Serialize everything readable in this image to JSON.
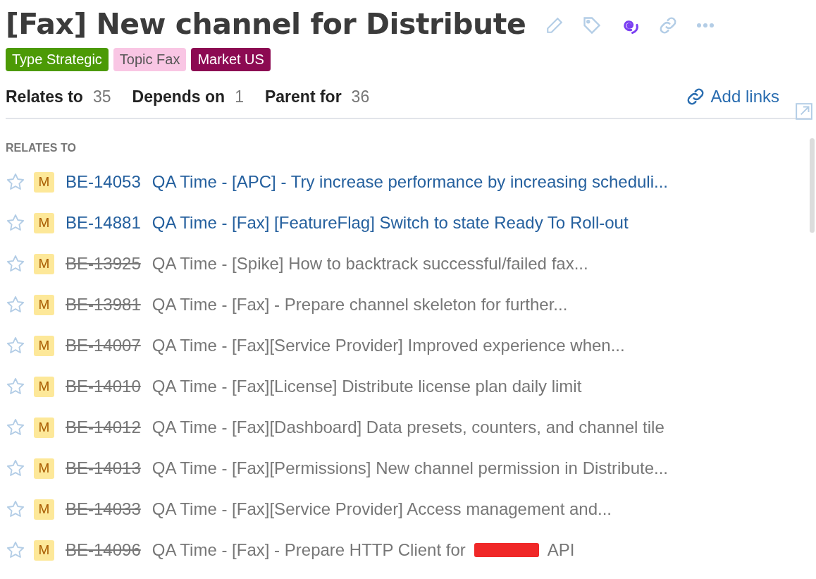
{
  "title": "[Fax] New channel for Distribute",
  "tags": [
    {
      "label": "Type Strategic",
      "color": "#4c9a06"
    },
    {
      "label": "Topic Fax",
      "color": "#f9c6e4"
    },
    {
      "label": "Market US",
      "color": "#8c0a52"
    }
  ],
  "link_tabs": [
    {
      "label": "Relates to",
      "count": "35"
    },
    {
      "label": "Depends on",
      "count": "1"
    },
    {
      "label": "Parent for",
      "count": "36"
    }
  ],
  "add_links": "Add links",
  "section_heading": "RELATES TO",
  "items": [
    {
      "starred": false,
      "priority": "M",
      "id": "BE-14053",
      "title": "QA Time - [APC] - Try increase performance by increasing scheduli...",
      "resolved": false
    },
    {
      "starred": false,
      "priority": "M",
      "id": "BE-14881",
      "title": "QA Time - [Fax] [FeatureFlag] Switch to state Ready To Roll-out",
      "resolved": false
    },
    {
      "starred": false,
      "priority": "M",
      "id": "BE-13925",
      "title": "QA Time - [Spike] How to backtrack successful/failed fax...",
      "resolved": true
    },
    {
      "starred": false,
      "priority": "M",
      "id": "BE-13981",
      "title": "QA Time - [Fax] - Prepare channel skeleton for further...",
      "resolved": true
    },
    {
      "starred": false,
      "priority": "M",
      "id": "BE-14007",
      "title": "QA Time - [Fax][Service Provider] Improved experience when...",
      "resolved": true
    },
    {
      "starred": false,
      "priority": "M",
      "id": "BE-14010",
      "title": "QA Time - [Fax][License] Distribute license plan daily limit",
      "resolved": true
    },
    {
      "starred": false,
      "priority": "M",
      "id": "BE-14012",
      "title": "QA Time - [Fax][Dashboard] Data presets, counters, and channel tile",
      "resolved": true
    },
    {
      "starred": false,
      "priority": "M",
      "id": "BE-14013",
      "title": "QA Time - [Fax][Permissions] New channel permission in Distribute...",
      "resolved": true
    },
    {
      "starred": false,
      "priority": "M",
      "id": "BE-14033",
      "title": "QA Time - [Fax][Service Provider] Access management and...",
      "resolved": true
    },
    {
      "starred": false,
      "priority": "M",
      "id": "BE-14096",
      "title": "QA Time - [Fax] - Prepare HTTP Client for",
      "redacted": true,
      "title_after": "API",
      "resolved": true
    }
  ]
}
